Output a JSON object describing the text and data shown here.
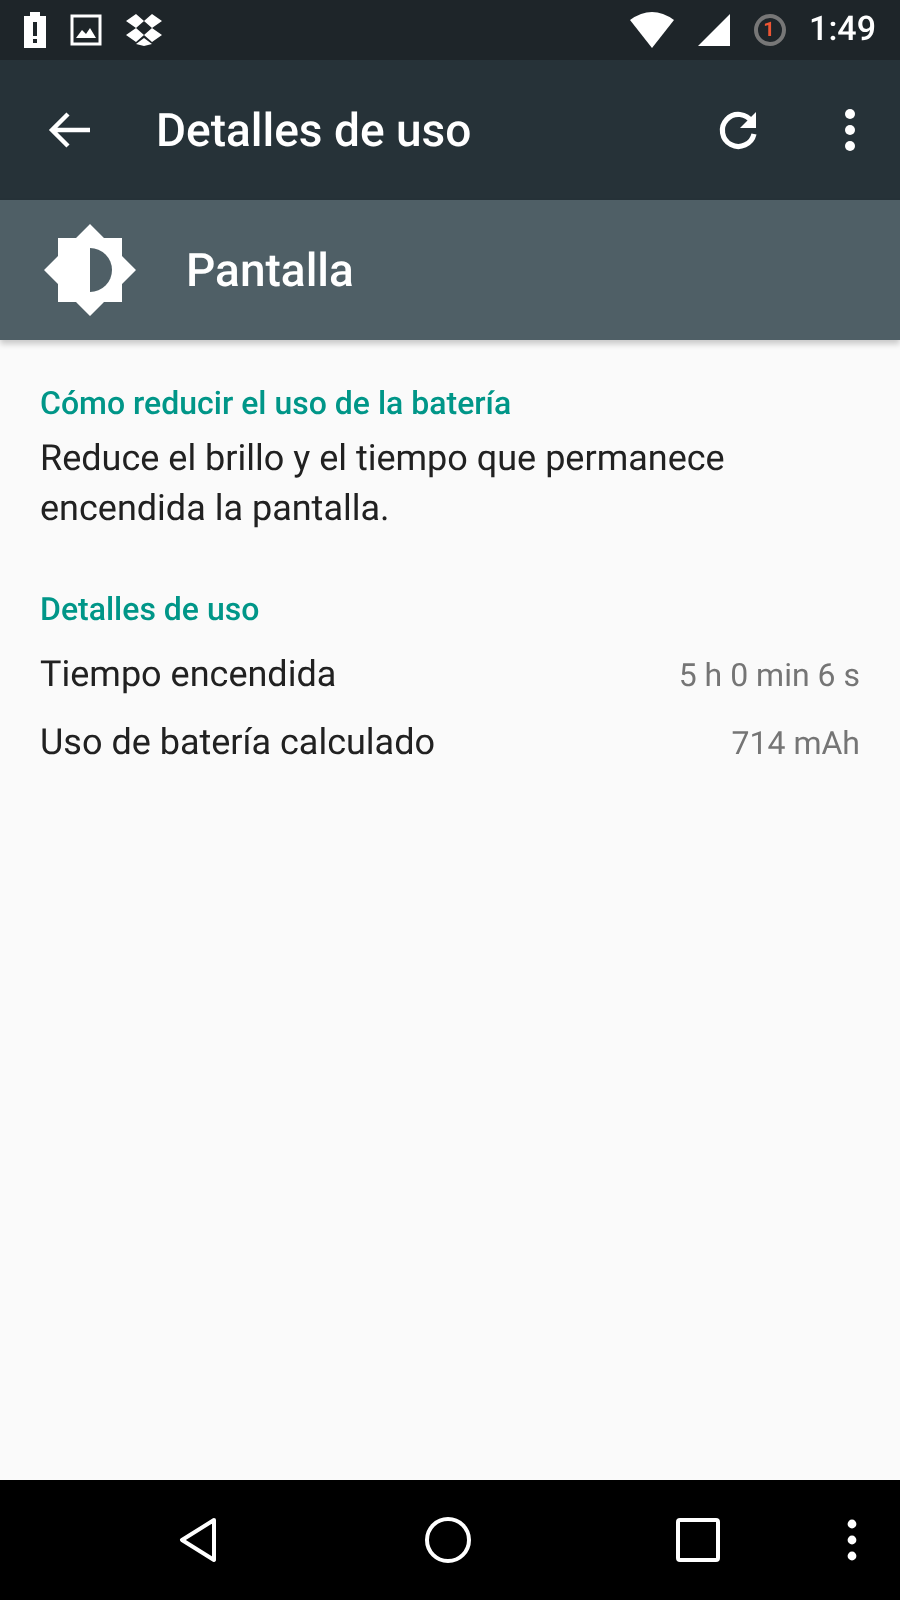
{
  "status_bar": {
    "notification_count": "1",
    "time": "1:49"
  },
  "toolbar": {
    "title": "Detalles de uso"
  },
  "header": {
    "title": "Pantalla"
  },
  "sections": [
    {
      "heading": "Cómo reducir el uso de la batería",
      "text": "Reduce el brillo y el tiempo que permanece encendida la pantalla."
    },
    {
      "heading": "Detalles de uso",
      "rows": [
        {
          "label": "Tiempo encendida",
          "value": "5 h 0 min 6 s"
        },
        {
          "label": "Uso de batería calculado",
          "value": "714 mAh"
        }
      ]
    }
  ]
}
